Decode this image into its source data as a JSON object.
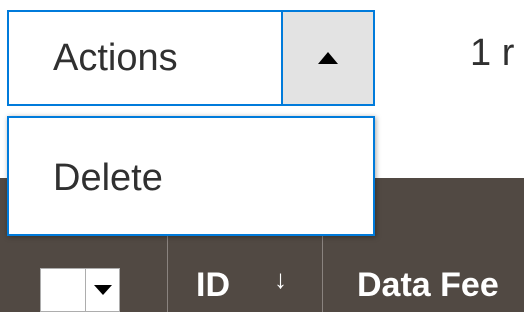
{
  "actions": {
    "label": "Actions",
    "toggle_icon": "triangle-up-icon"
  },
  "records": {
    "text": "1 r"
  },
  "menu": {
    "items": [
      {
        "label": "Delete"
      }
    ]
  },
  "grid": {
    "columns": [
      {
        "label": "ID",
        "sort_icon": "↓"
      },
      {
        "label": "Data Fee"
      }
    ],
    "mass_select_icon": "triangle-down-icon"
  },
  "colors": {
    "accent": "#007bdb",
    "header_bg": "#514943",
    "toggle_bg": "#e3e3e3"
  }
}
